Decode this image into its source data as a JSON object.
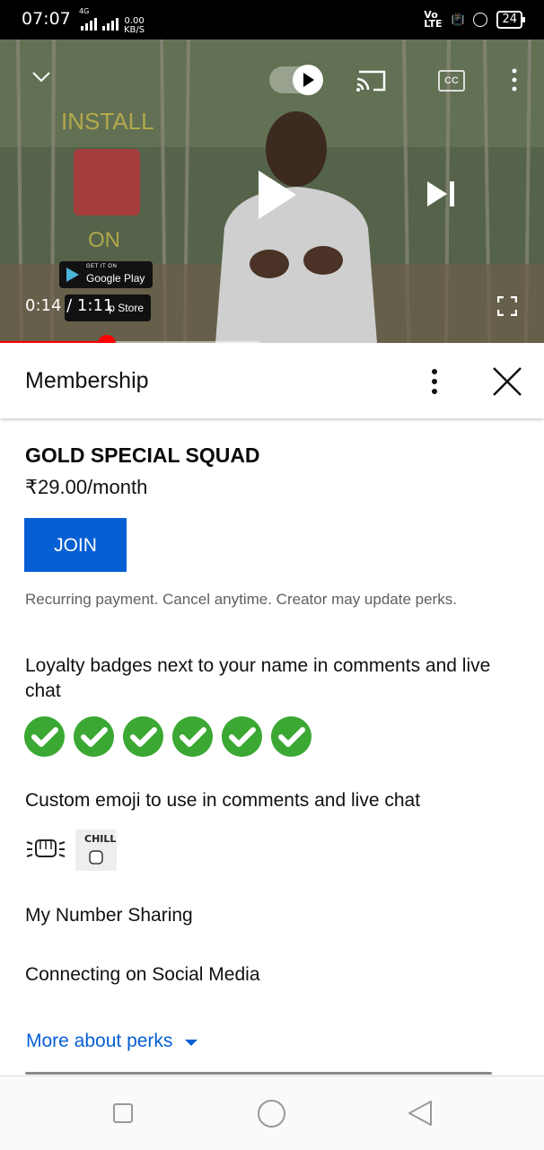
{
  "status_bar": {
    "time": "07:07",
    "network": "4G",
    "speed_value": "0.00",
    "speed_unit": "KB/S",
    "volte": "Vo\nLTE",
    "battery": "24"
  },
  "video": {
    "overlay_install": "INSTALL",
    "overlay_on": "ON",
    "google_play_small": "GET IT ON",
    "google_play_label": "Google Play",
    "app_store_label": "p Store",
    "time_label": "0:14 / 1:11",
    "progress": 0.196
  },
  "panel": {
    "title": "Membership"
  },
  "membership": {
    "tier_name": "GOLD SPECIAL SQUAD",
    "price": "₹29.00/month",
    "join_label": "JOIN",
    "note": "Recurring payment. Cancel anytime. Creator may update perks.",
    "perks": [
      "Loyalty badges next to your name in comments and live chat",
      "Custom emoji to use in comments and live chat",
      "My Number Sharing",
      "Connecting on Social Media"
    ],
    "badge_count": 6,
    "emoji2_text": "CHILL",
    "more_perks_label": "More about perks"
  },
  "colors": {
    "accent": "#065fd4",
    "progress": "#ff0000",
    "badge": "#3aa832"
  }
}
